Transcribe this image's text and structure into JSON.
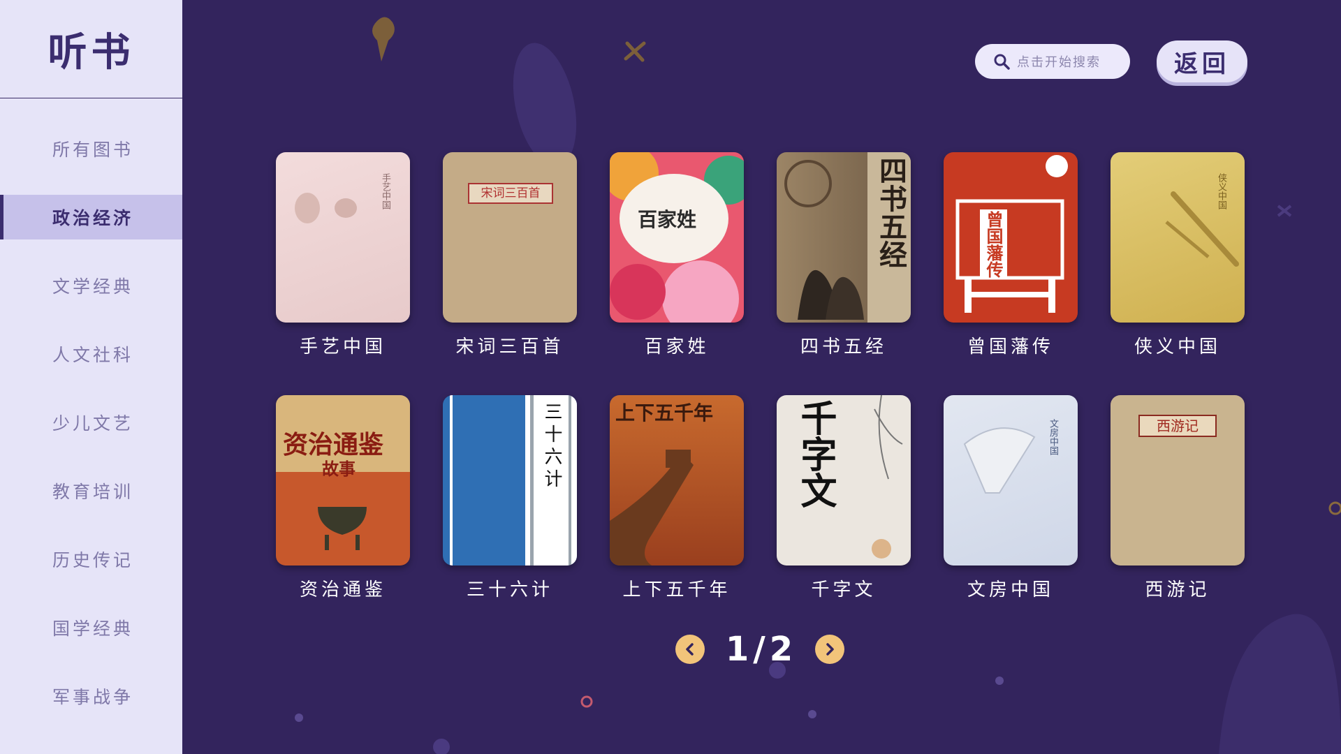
{
  "app": {
    "title": "听书"
  },
  "sidebar": {
    "items": [
      {
        "label": "所有图书",
        "active": false
      },
      {
        "label": "政治经济",
        "active": true
      },
      {
        "label": "文学经典",
        "active": false
      },
      {
        "label": "人文社科",
        "active": false
      },
      {
        "label": "少儿文艺",
        "active": false
      },
      {
        "label": "教育培训",
        "active": false
      },
      {
        "label": "历史传记",
        "active": false
      },
      {
        "label": "国学经典",
        "active": false
      },
      {
        "label": "军事战争",
        "active": false
      }
    ]
  },
  "header": {
    "search_placeholder": "点击开始搜索",
    "back_label": "返回",
    "search_icon": "search-icon"
  },
  "books": [
    {
      "title": "手艺中国",
      "cover_text": "手艺中国",
      "cover_color": "#efd6d6"
    },
    {
      "title": "宋词三百首",
      "cover_text": "宋词三百首",
      "cover_color": "#c4ab87"
    },
    {
      "title": "百家姓",
      "cover_text": "百家姓",
      "cover_color": "#e9586f"
    },
    {
      "title": "四书五经",
      "cover_text": "四书五经",
      "cover_color": "#8e7355"
    },
    {
      "title": "曾国藩传",
      "cover_text": "曾国藩传",
      "cover_color": "#c73a22"
    },
    {
      "title": "侠义中国",
      "cover_text": "侠义中国",
      "cover_color": "#dcc162"
    },
    {
      "title": "资治通鉴",
      "cover_text": "资治通鉴",
      "cover_sub": "故事",
      "cover_color": "#c7582c"
    },
    {
      "title": "三十六计",
      "cover_text": "三十六计",
      "cover_color": "#2f6fb4"
    },
    {
      "title": "上下五千年",
      "cover_text": "上下五千年",
      "cover_color": "#b3552a"
    },
    {
      "title": "千字文",
      "cover_text": "千字文",
      "cover_color": "#e9e4dc"
    },
    {
      "title": "文房中国",
      "cover_text": "文房中国",
      "cover_color": "#d9e0ee"
    },
    {
      "title": "西游记",
      "cover_text": "西游记",
      "cover_color": "#c9b48f"
    }
  ],
  "pager": {
    "current": "1",
    "total": "2",
    "label": "1/2"
  },
  "colors": {
    "background": "#33245d",
    "sidebar": "#e6e4f8",
    "accent": "#f2c47a"
  }
}
